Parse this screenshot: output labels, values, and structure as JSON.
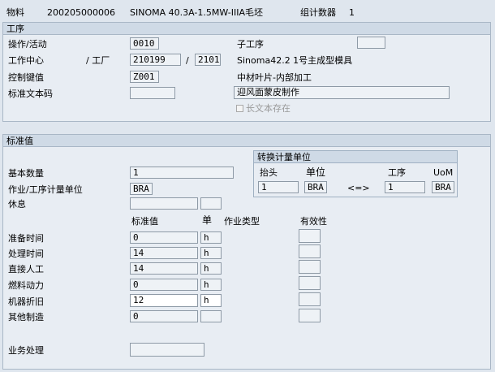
{
  "header": {
    "material_label": "物料",
    "material_number": "200205000006",
    "material_desc": "SINOMA 40.3A-1.5MW-IIIA毛坯",
    "group_counter_label": "组计数器",
    "group_counter_value": "1"
  },
  "operation": {
    "title": "工序",
    "op_activity_label": "操作/活动",
    "op_activity_value": "0010",
    "sub_op_label": "子工序",
    "sub_op_value": "",
    "work_center_label": "工作中心",
    "plant_label": "/ 工厂",
    "work_center_value": "210199",
    "slash": "/",
    "plant_value": "2101",
    "work_center_desc": "Sinoma42.2 1号主成型模具",
    "control_key_label": "控制键值",
    "control_key_value": "Z001",
    "control_key_desc": "中材叶片-内部加工",
    "std_text_label": "标准文本码",
    "std_text_value": "",
    "op_short_text": "迎风面蒙皮制作",
    "long_text_label": "长文本存在"
  },
  "standard_values": {
    "title": "标准值",
    "base_qty_label": "基本数量",
    "base_qty_value": "1",
    "uom_label": "作业/工序计量单位",
    "uom_value": "BRA",
    "break_label": "休息",
    "break_value": "",
    "break_unit": "",
    "col_std_value": "标准值",
    "col_unit": "单",
    "col_activity_type": "作业类型",
    "col_validity": "有效性",
    "rows": [
      {
        "label": "准备时间",
        "value": "0",
        "unit": "h"
      },
      {
        "label": "处理时间",
        "value": "14",
        "unit": "h"
      },
      {
        "label": "直接人工",
        "value": "14",
        "unit": "h"
      },
      {
        "label": "燃料动力",
        "value": "0",
        "unit": "h"
      },
      {
        "label": "机器折旧",
        "value": "12",
        "unit": "h"
      },
      {
        "label": "其他制造",
        "value": "0",
        "unit": ""
      }
    ],
    "business_process_label": "业务处理",
    "business_process_value": ""
  },
  "conversion": {
    "title": "转换计量单位",
    "header_label": "抬头",
    "unit_label": "单位",
    "operation_label": "工序",
    "uom_label": "UoM",
    "header_qty": "1",
    "header_uom": "BRA",
    "arrow": "<=>",
    "op_qty": "1",
    "op_uom": "BRA"
  }
}
